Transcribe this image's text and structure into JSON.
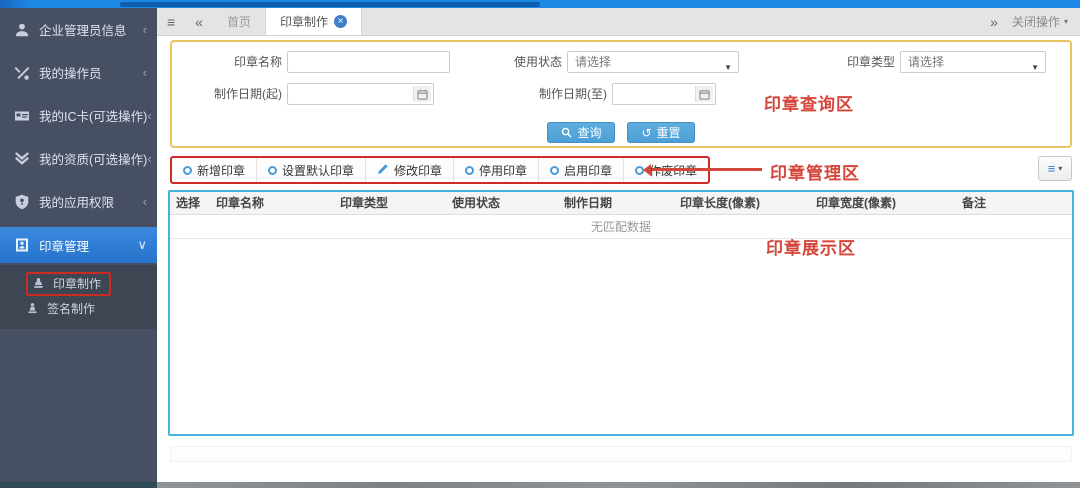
{
  "colors": {
    "topstrip_blue": "#1e88e5",
    "sidebar_bg": "#475063",
    "active_item_blue": "#2d7fd6",
    "annotation_red": "#d4453a",
    "annotation_yellow": "#eac45f",
    "annotation_blue": "#45b4dc",
    "button_blue": "#52a4d9"
  },
  "icons": {
    "hamburger": "≡",
    "rewind": "«",
    "forward": "»",
    "caret_down_small": "▾",
    "select_caret": "▼",
    "chevron_collapsed": "‹",
    "chevron_expanded": "∨",
    "tab_close": "×",
    "reset_glyph": "↺",
    "list_bars": "≡"
  },
  "tabbar": {
    "home_tab": "首页",
    "active_tab": "印章制作",
    "close_ops": "关闭操作"
  },
  "sidebar": {
    "items": [
      {
        "label": "企业管理员信息",
        "icon": "user-icon"
      },
      {
        "label": "我的操作员",
        "icon": "tools-icon"
      },
      {
        "label": "我的IC卡(可选操作)",
        "icon": "ic-card-icon"
      },
      {
        "label": "我的资质(可选操作)",
        "icon": "qualification-icon"
      },
      {
        "label": "我的应用权限",
        "icon": "shield-icon"
      },
      {
        "label": "印章管理",
        "icon": "seal-book-icon"
      }
    ],
    "subitems": [
      {
        "label": "印章制作",
        "icon": "stamp-icon"
      },
      {
        "label": "签名制作",
        "icon": "signature-stamp-icon"
      }
    ]
  },
  "search": {
    "seal_name_label": "印章名称",
    "use_status_label": "使用状态",
    "seal_type_label": "印章类型",
    "date_from_label": "制作日期(起)",
    "date_to_label": "制作日期(至)",
    "select_placeholder": "请选择",
    "search_button": "查询",
    "reset_button": "重置",
    "annotation": "印章查询区"
  },
  "toolbar": {
    "buttons": [
      {
        "label": "新增印章",
        "icon": "add-seal-circle-icon"
      },
      {
        "label": "设置默认印章",
        "icon": "default-seal-circle-icon"
      },
      {
        "label": "修改印章",
        "icon": "edit-seal-pencil-icon"
      },
      {
        "label": "停用印章",
        "icon": "disable-seal-circle-icon"
      },
      {
        "label": "启用印章",
        "icon": "enable-seal-circle-icon"
      },
      {
        "label": "作废印章",
        "icon": "void-seal-circle-icon"
      }
    ],
    "annotation": "印章管理区"
  },
  "table": {
    "columns": [
      "选择",
      "印章名称",
      "印章类型",
      "使用状态",
      "制作日期",
      "印章长度(像素)",
      "印章宽度(像素)",
      "备注"
    ],
    "empty_text": "无匹配数据",
    "annotation": "印章展示区"
  }
}
